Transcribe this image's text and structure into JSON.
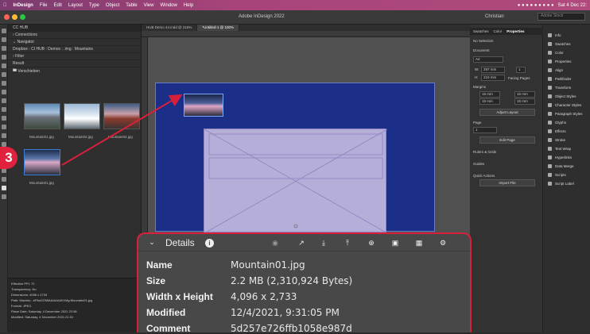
{
  "menubar": {
    "app": "InDesign",
    "items": [
      "File",
      "Edit",
      "Layout",
      "Type",
      "Object",
      "Table",
      "View",
      "Window",
      "Help"
    ],
    "clock": "Sat 4 Dec 22:"
  },
  "titlebar": {
    "title": "Adobe InDesign 2022",
    "user": "Christian",
    "search_placeholder": "Adobe Stock"
  },
  "left_panel": {
    "header": "CC HUB",
    "connections": "Connections",
    "navigator": "Navigator",
    "breadcrumb": "Dropbox : CI HUB : Demos : .img : Mountains",
    "filter": "Filter",
    "result": "Result",
    "folder": "Verschieben",
    "thumbs": [
      "Mountain01.jpg",
      "Mountain02.jpg",
      "Mountain04.jpg",
      "Mountain01.jpg"
    ]
  },
  "info": {
    "ppi": "Effective PPI: 72",
    "transparency": "Transparency: No",
    "dimensions": "Dimensions: 4096 x 2733",
    "path": "Path: Macinto...bPAsGZMtAAAAAAVVMg:Mountain01.jpg",
    "format": "Format: JPEG",
    "placed": "Place Date: Saturday, 4 December 2021 22:58",
    "modified": "Modified: Saturday, 4 December 2021 21:31"
  },
  "canvas": {
    "tabs": [
      "HUB Demo 44.indd @ 218%",
      "*Untitled-1 @ 100%"
    ]
  },
  "right_panel": {
    "tabs": [
      "Swatches",
      "Color",
      "Properties"
    ],
    "no_selection": "No Selection",
    "document": "Document",
    "size": "A4",
    "width": "297 mm",
    "height": "210 mm",
    "pages": "1",
    "facing": "Facing Pages",
    "margins": "Margins",
    "margin_vals": [
      "15 mm",
      "15 mm",
      "15 mm",
      "15 mm"
    ],
    "adjust_layout": "Adjust Layout",
    "page": "Page",
    "page_num": "1",
    "edit_page": "Edit Page",
    "rulers": "Rulers & Grids",
    "guides": "Guides",
    "quick_actions": "Quick Actions",
    "import_file": "Import File"
  },
  "panel_icons": {
    "items": [
      "Info",
      "Swatches",
      "Color",
      "Properties",
      "Align",
      "Pathfinder",
      "Transform",
      "Object Styles",
      "Character Styles",
      "Paragraph Styles",
      "Glyphs",
      "Effects",
      "Stroke",
      "Text Wrap",
      "Hyperlinks",
      "Data Merge",
      "Scripts",
      "Script Label"
    ]
  },
  "badge": "3",
  "details": {
    "title": "Details",
    "name_label": "Name",
    "name": "Mountain01.jpg",
    "size_label": "Size",
    "size": "2.2 MB (2,310,924 Bytes)",
    "wh_label": "Width x Height",
    "wh": "4,096 x 2,733",
    "modified_label": "Modified",
    "modified": "12/4/2021, 9:31:05 PM",
    "comment_label": "Comment",
    "comment": "5d257e726ffb1058e987d"
  },
  "colors": {
    "accent": "#d81f3b",
    "page_bg": "#1c2f88",
    "frame": "#b4aed8"
  }
}
